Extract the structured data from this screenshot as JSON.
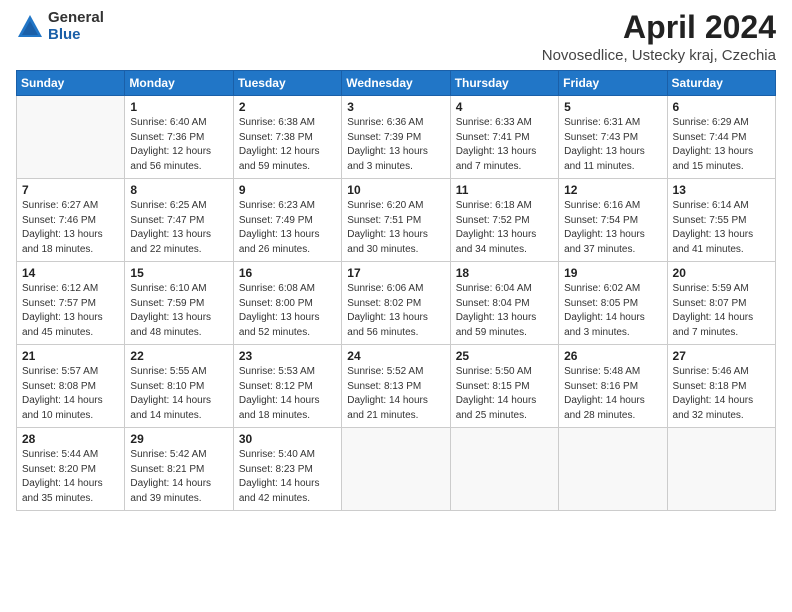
{
  "logo": {
    "general": "General",
    "blue": "Blue"
  },
  "title": "April 2024",
  "subtitle": "Novosedlice, Ustecky kraj, Czechia",
  "days_header": [
    "Sunday",
    "Monday",
    "Tuesday",
    "Wednesday",
    "Thursday",
    "Friday",
    "Saturday"
  ],
  "weeks": [
    [
      {
        "day": "",
        "info": ""
      },
      {
        "day": "1",
        "info": "Sunrise: 6:40 AM\nSunset: 7:36 PM\nDaylight: 12 hours\nand 56 minutes."
      },
      {
        "day": "2",
        "info": "Sunrise: 6:38 AM\nSunset: 7:38 PM\nDaylight: 12 hours\nand 59 minutes."
      },
      {
        "day": "3",
        "info": "Sunrise: 6:36 AM\nSunset: 7:39 PM\nDaylight: 13 hours\nand 3 minutes."
      },
      {
        "day": "4",
        "info": "Sunrise: 6:33 AM\nSunset: 7:41 PM\nDaylight: 13 hours\nand 7 minutes."
      },
      {
        "day": "5",
        "info": "Sunrise: 6:31 AM\nSunset: 7:43 PM\nDaylight: 13 hours\nand 11 minutes."
      },
      {
        "day": "6",
        "info": "Sunrise: 6:29 AM\nSunset: 7:44 PM\nDaylight: 13 hours\nand 15 minutes."
      }
    ],
    [
      {
        "day": "7",
        "info": "Sunrise: 6:27 AM\nSunset: 7:46 PM\nDaylight: 13 hours\nand 18 minutes."
      },
      {
        "day": "8",
        "info": "Sunrise: 6:25 AM\nSunset: 7:47 PM\nDaylight: 13 hours\nand 22 minutes."
      },
      {
        "day": "9",
        "info": "Sunrise: 6:23 AM\nSunset: 7:49 PM\nDaylight: 13 hours\nand 26 minutes."
      },
      {
        "day": "10",
        "info": "Sunrise: 6:20 AM\nSunset: 7:51 PM\nDaylight: 13 hours\nand 30 minutes."
      },
      {
        "day": "11",
        "info": "Sunrise: 6:18 AM\nSunset: 7:52 PM\nDaylight: 13 hours\nand 34 minutes."
      },
      {
        "day": "12",
        "info": "Sunrise: 6:16 AM\nSunset: 7:54 PM\nDaylight: 13 hours\nand 37 minutes."
      },
      {
        "day": "13",
        "info": "Sunrise: 6:14 AM\nSunset: 7:55 PM\nDaylight: 13 hours\nand 41 minutes."
      }
    ],
    [
      {
        "day": "14",
        "info": "Sunrise: 6:12 AM\nSunset: 7:57 PM\nDaylight: 13 hours\nand 45 minutes."
      },
      {
        "day": "15",
        "info": "Sunrise: 6:10 AM\nSunset: 7:59 PM\nDaylight: 13 hours\nand 48 minutes."
      },
      {
        "day": "16",
        "info": "Sunrise: 6:08 AM\nSunset: 8:00 PM\nDaylight: 13 hours\nand 52 minutes."
      },
      {
        "day": "17",
        "info": "Sunrise: 6:06 AM\nSunset: 8:02 PM\nDaylight: 13 hours\nand 56 minutes."
      },
      {
        "day": "18",
        "info": "Sunrise: 6:04 AM\nSunset: 8:04 PM\nDaylight: 13 hours\nand 59 minutes."
      },
      {
        "day": "19",
        "info": "Sunrise: 6:02 AM\nSunset: 8:05 PM\nDaylight: 14 hours\nand 3 minutes."
      },
      {
        "day": "20",
        "info": "Sunrise: 5:59 AM\nSunset: 8:07 PM\nDaylight: 14 hours\nand 7 minutes."
      }
    ],
    [
      {
        "day": "21",
        "info": "Sunrise: 5:57 AM\nSunset: 8:08 PM\nDaylight: 14 hours\nand 10 minutes."
      },
      {
        "day": "22",
        "info": "Sunrise: 5:55 AM\nSunset: 8:10 PM\nDaylight: 14 hours\nand 14 minutes."
      },
      {
        "day": "23",
        "info": "Sunrise: 5:53 AM\nSunset: 8:12 PM\nDaylight: 14 hours\nand 18 minutes."
      },
      {
        "day": "24",
        "info": "Sunrise: 5:52 AM\nSunset: 8:13 PM\nDaylight: 14 hours\nand 21 minutes."
      },
      {
        "day": "25",
        "info": "Sunrise: 5:50 AM\nSunset: 8:15 PM\nDaylight: 14 hours\nand 25 minutes."
      },
      {
        "day": "26",
        "info": "Sunrise: 5:48 AM\nSunset: 8:16 PM\nDaylight: 14 hours\nand 28 minutes."
      },
      {
        "day": "27",
        "info": "Sunrise: 5:46 AM\nSunset: 8:18 PM\nDaylight: 14 hours\nand 32 minutes."
      }
    ],
    [
      {
        "day": "28",
        "info": "Sunrise: 5:44 AM\nSunset: 8:20 PM\nDaylight: 14 hours\nand 35 minutes."
      },
      {
        "day": "29",
        "info": "Sunrise: 5:42 AM\nSunset: 8:21 PM\nDaylight: 14 hours\nand 39 minutes."
      },
      {
        "day": "30",
        "info": "Sunrise: 5:40 AM\nSunset: 8:23 PM\nDaylight: 14 hours\nand 42 minutes."
      },
      {
        "day": "",
        "info": ""
      },
      {
        "day": "",
        "info": ""
      },
      {
        "day": "",
        "info": ""
      },
      {
        "day": "",
        "info": ""
      }
    ]
  ]
}
